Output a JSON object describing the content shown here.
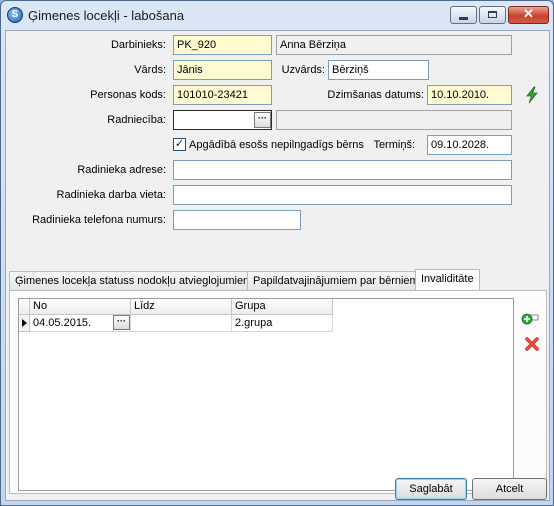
{
  "window": {
    "title": "Ģimenes locekļi - labošana",
    "app_icon_glyph": "S"
  },
  "form": {
    "darbinieks": {
      "label": "Darbinieks:",
      "code": "PK_920",
      "name": "Anna Bērziņa"
    },
    "vards": {
      "label": "Vārds:",
      "value": "Jānis"
    },
    "uzvards": {
      "label": "Uzvārds:",
      "value": "Bērziņš"
    },
    "personas_kods": {
      "label": "Personas kods:",
      "value": "101010-23421"
    },
    "dzimsanas_datums": {
      "label": "Dzimšanas datums:",
      "value": "10.10.2010."
    },
    "radnieciba": {
      "label": "Radniecība:",
      "value": "",
      "description": ""
    },
    "apgadiba": {
      "label": "Apgādībā esošs nepilngadīgs bērns",
      "checked": true,
      "check_glyph": "✓"
    },
    "termins": {
      "label": "Termiņš:",
      "value": "09.10.2028."
    },
    "adrese": {
      "label": "Radinieka adrese:",
      "value": ""
    },
    "darba_vieta": {
      "label": "Radinieka darba vieta:",
      "value": ""
    },
    "telefons": {
      "label": "Radinieka telefona numurs:",
      "value": ""
    },
    "ellipsis": "···"
  },
  "tabs": [
    {
      "label": "Ģimenes locekļa statuss nodokļu atvieglojumiem",
      "active": false
    },
    {
      "label": "Papildatvajinājumiem par bērniem",
      "active": false
    },
    {
      "label": "Invaliditāte",
      "active": true
    }
  ],
  "grid": {
    "columns": [
      "No",
      "Līdz",
      "Grupa"
    ],
    "rows": [
      {
        "no": "04.05.2015.",
        "lidz": "",
        "grupa": "2.grupa"
      }
    ]
  },
  "buttons": {
    "save": "Saglabāt",
    "cancel": "Atcelt",
    "add_icon": "add-icon",
    "delete_icon": "delete-icon"
  },
  "colors": {
    "required_field": "#fffbd0",
    "titlebar": "#c4d6ec",
    "close_button": "#c7432f"
  }
}
